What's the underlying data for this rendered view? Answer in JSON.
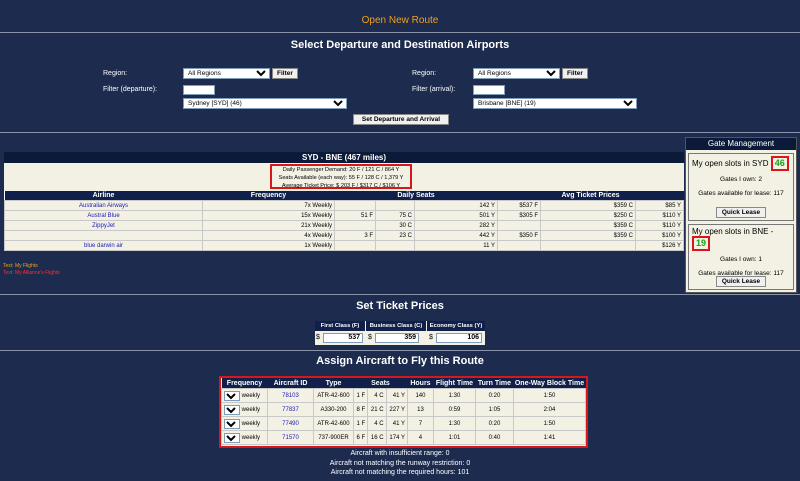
{
  "page_title": "Open New Route",
  "select_section": {
    "heading": "Select Departure and Destination Airports",
    "left": {
      "region_label": "Region:",
      "region_value": "All Regions",
      "filter_button": "Filter",
      "filter_label": "Filter (departure):",
      "filter_value": "",
      "airport_value": "Sydney [SYD] (46)"
    },
    "right": {
      "region_label": "Region:",
      "region_value": "All Regions",
      "filter_button": "Filter",
      "filter_label": "Filter (arrival):",
      "filter_value": "",
      "airport_value": "Brisbane [BNE] (19)"
    },
    "submit_button": "Set Departure and Arrival"
  },
  "route": {
    "header": "SYD - BNE (467 miles)",
    "demand": "Daily Passenger Demand: 20 F / 121 C / 864 Y",
    "seats_available": "Seats Available (each way): 55 F / 128 C / 1,379 Y",
    "avg_price": "Average Ticket Price: $ 203 F / $317 C / $106 Y",
    "columns": [
      "Airline",
      "Frequency",
      "Daily Seats",
      "Avg Ticket Prices"
    ],
    "rows": [
      {
        "airline": "Australian Airways",
        "frequency": "7x Weekly",
        "f": "",
        "c": "",
        "y": "142 Y",
        "pf": "$537 F",
        "pc": "$359 C",
        "py": "$85 Y"
      },
      {
        "airline": "Austral Blue",
        "frequency": "15x Weekly",
        "f": "51 F",
        "c": "75 C",
        "y": "501 Y",
        "pf": "$305 F",
        "pc": "$250 C",
        "py": "$110 Y"
      },
      {
        "airline": "ZippyJet",
        "frequency": "21x Weekly",
        "f": "",
        "c": "30 C",
        "y": "282 Y",
        "pf": "",
        "pc": "$359 C",
        "py": "$110 Y"
      },
      {
        "airline": "",
        "frequency": "4x Weekly",
        "f": "3 F",
        "c": "23 C",
        "y": "442 Y",
        "pf": "$350 F",
        "pc": "$359 C",
        "py": "$100 Y"
      },
      {
        "airline": "blue darwin air",
        "frequency": "1x Weekly",
        "f": "",
        "c": "",
        "y": "11 Y",
        "pf": "",
        "pc": "",
        "py": "$126 Y"
      }
    ],
    "legend": [
      "Text: My Flights",
      "Text: My Alliance's Flights"
    ]
  },
  "gate": {
    "title": "Gate Management",
    "syd": {
      "label": "My open slots in SYD",
      "slots": "46",
      "gates_own": "Gates I own: 2",
      "gates_lease": "Gates available for lease: 117",
      "button": "Quick Lease"
    },
    "bne": {
      "label": "My open slots in BNE -",
      "slots": "19",
      "gates_own": "Gates I own: 1",
      "gates_lease": "Gates available for lease: 117",
      "button": "Quick Lease"
    }
  },
  "tickets": {
    "heading": "Set Ticket Prices",
    "first_label": "First Class (F)",
    "business_label": "Business Class (C)",
    "economy_label": "Economy Class (Y)",
    "currency": "$",
    "first": "537",
    "business": "359",
    "economy": "106"
  },
  "aircraft": {
    "heading": "Assign Aircraft to Fly this Route",
    "columns": [
      "Frequency",
      "Aircraft ID",
      "Type",
      "Seats",
      "Hours",
      "Flight Time",
      "Turn Time",
      "One-Way Block Time"
    ],
    "rows": [
      {
        "freq": "0",
        "unit": "weekly",
        "id": "78103",
        "type": "ATR-42-600",
        "f": "1 F",
        "c": "4 C",
        "y": "41 Y",
        "hours": "140",
        "flight": "1:30",
        "turn": "0:20",
        "block": "1:50"
      },
      {
        "freq": "0",
        "unit": "weekly",
        "id": "77837",
        "type": "A330-200",
        "f": "8 F",
        "c": "21 C",
        "y": "227 Y",
        "hours": "13",
        "flight": "0:59",
        "turn": "1:05",
        "block": "2:04"
      },
      {
        "freq": "0",
        "unit": "weekly",
        "id": "77490",
        "type": "ATR-42-600",
        "f": "1 F",
        "c": "4 C",
        "y": "41 Y",
        "hours": "7",
        "flight": "1:30",
        "turn": "0:20",
        "block": "1:50"
      },
      {
        "freq": "0",
        "unit": "weekly",
        "id": "71570",
        "type": "737-900ER",
        "f": "6 F",
        "c": "16 C",
        "y": "174 Y",
        "hours": "4",
        "flight": "1:01",
        "turn": "0:40",
        "block": "1:41"
      }
    ]
  },
  "footer": {
    "insufficient_range": "Aircraft with insufficient range: 0",
    "runway": "Aircraft not matching the runway restriction: 0",
    "hours": "Aircraft not matching the required hours: 101"
  },
  "colors": {
    "background": "#1c2b4e",
    "title": "#f0a020",
    "highlight": "#d81818",
    "slots_green": "#1da01d"
  }
}
